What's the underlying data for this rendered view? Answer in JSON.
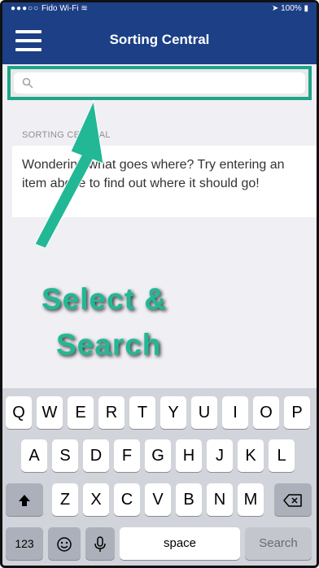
{
  "status_bar": {
    "carrier": "Fido Wi-Fi",
    "battery": "100%"
  },
  "nav": {
    "title": "Sorting Central",
    "menu_icon": "hamburger-menu-icon"
  },
  "search": {
    "placeholder": "",
    "value": ""
  },
  "content": {
    "section_header": "SORTING CENTRAL",
    "info_text": "Wondering what goes where? Try entering an item above to find out where it should go!"
  },
  "overlay": {
    "line1": "Select &",
    "line2": "Search",
    "color": "#22b895"
  },
  "keyboard": {
    "row1": [
      "Q",
      "W",
      "E",
      "R",
      "T",
      "Y",
      "U",
      "I",
      "O",
      "P"
    ],
    "row2": [
      "A",
      "S",
      "D",
      "F",
      "G",
      "H",
      "J",
      "K",
      "L"
    ],
    "row3": [
      "Z",
      "X",
      "C",
      "V",
      "B",
      "N",
      "M"
    ],
    "numbers_label": "123",
    "space_label": "space",
    "search_label": "Search"
  },
  "colors": {
    "nav_bg": "#1c3f86",
    "accent": "#1ea588"
  }
}
